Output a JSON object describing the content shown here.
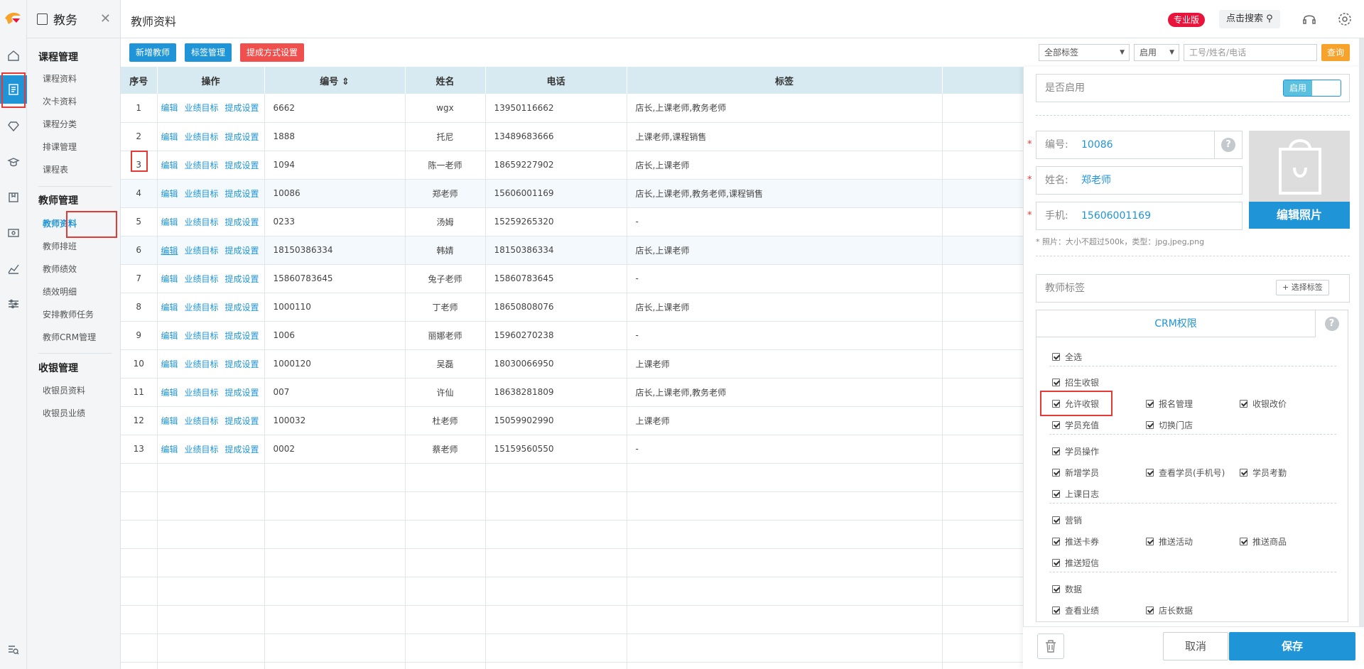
{
  "sidebar_rail": {
    "icons": [
      "home-icon",
      "document-icon",
      "diamond-icon",
      "student-icon",
      "book-icon",
      "payment-icon",
      "chart-icon",
      "settings-sliders-icon",
      "search-list-icon"
    ],
    "accent": "#1f95d8"
  },
  "submenu": {
    "title": "教务",
    "groups": [
      {
        "label": "课程管理",
        "items": [
          "课程资料",
          "次卡资料",
          "课程分类",
          "排课管理",
          "课程表"
        ]
      },
      {
        "label": "教师管理",
        "items": [
          "教师资料",
          "教师排班",
          "教师绩效",
          "绩效明细",
          "安排教师任务",
          "教师CRM管理"
        ]
      },
      {
        "label": "收银管理",
        "items": [
          "收银员资料",
          "收银员业绩"
        ]
      }
    ]
  },
  "header": {
    "page_title": "教师资料",
    "badge": "专业版",
    "search_label": "点击搜索"
  },
  "toolbar": {
    "add_label": "新增教师",
    "tag_label": "标签管理",
    "commission_label": "提成方式设置"
  },
  "filters": {
    "tag_select": "全部标签",
    "status_select": "启用",
    "keyword_placeholder": "工号/姓名/电话",
    "query_label": "查询"
  },
  "table": {
    "columns": [
      "序号",
      "操作",
      "编号",
      "姓名",
      "电话",
      "标签"
    ],
    "actions": [
      "编辑",
      "业绩目标",
      "提成设置"
    ],
    "rows": [
      {
        "no": "1",
        "code": "6662",
        "name": "wgx",
        "phone": "13950116662",
        "tags": "店长,上课老师,教务老师"
      },
      {
        "no": "2",
        "code": "1888",
        "name": "托尼",
        "phone": "13489683666",
        "tags": "上课老师,课程销售"
      },
      {
        "no": "3",
        "code": "1094",
        "name": "陈一老师",
        "phone": "18659227902",
        "tags": "店长,上课老师"
      },
      {
        "no": "4",
        "code": "10086",
        "name": "郑老师",
        "phone": "15606001169",
        "tags": "店长,上课老师,教务老师,课程销售"
      },
      {
        "no": "5",
        "code": "0233",
        "name": "汤姆",
        "phone": "15259265320",
        "tags": "-"
      },
      {
        "no": "6",
        "code": "18150386334",
        "name": "韩婧",
        "phone": "18150386334",
        "tags": "店长,上课老师"
      },
      {
        "no": "7",
        "code": "15860783645",
        "name": "兔子老师",
        "phone": "15860783645",
        "tags": "-"
      },
      {
        "no": "8",
        "code": "1000110",
        "name": "丁老师",
        "phone": "18650808076",
        "tags": "店长,上课老师"
      },
      {
        "no": "9",
        "code": "1006",
        "name": "丽娜老师",
        "phone": "15960270238",
        "tags": "-"
      },
      {
        "no": "10",
        "code": "1000120",
        "name": "吴磊",
        "phone": "18030066950",
        "tags": "上课老师"
      },
      {
        "no": "11",
        "code": "007",
        "name": "许仙",
        "phone": "18638281809",
        "tags": "店长,上课老师,教务老师"
      },
      {
        "no": "12",
        "code": "100032",
        "name": "杜老师",
        "phone": "15059902990",
        "tags": "上课老师"
      },
      {
        "no": "13",
        "code": "0002",
        "name": "蔡老师",
        "phone": "15159560550",
        "tags": "-"
      }
    ]
  },
  "panel": {
    "enabled_label": "是否启用",
    "enabled_value": "启用",
    "code_label": "编号:",
    "code_value": "10086",
    "name_label": "姓名:",
    "name_value": "郑老师",
    "phone_label": "手机:",
    "phone_value": "15606001169",
    "photo_label": "编辑照片",
    "photo_hint": "* 照片：大小不超过500k，类型：jpg,jpeg,png",
    "tag_label": "教师标签",
    "tag_button": "+ 选择标签",
    "crm_title": "CRM权限",
    "select_all": "全选",
    "sections": [
      {
        "label": "招生收银",
        "items": [
          "允许收银",
          "报名管理",
          "收银改价",
          "学员充值",
          "切换门店"
        ]
      },
      {
        "label": "学员操作",
        "items": [
          "新增学员",
          "查看学员(手机号)",
          "学员考勤",
          "上课日志"
        ]
      },
      {
        "label": "营销",
        "items": [
          "推送卡券",
          "推送活动",
          "推送商品",
          "推送短信"
        ]
      },
      {
        "label": "数据",
        "items": [
          "查看业绩",
          "店长数据"
        ]
      }
    ],
    "cancel_label": "取消",
    "save_label": "保存"
  }
}
